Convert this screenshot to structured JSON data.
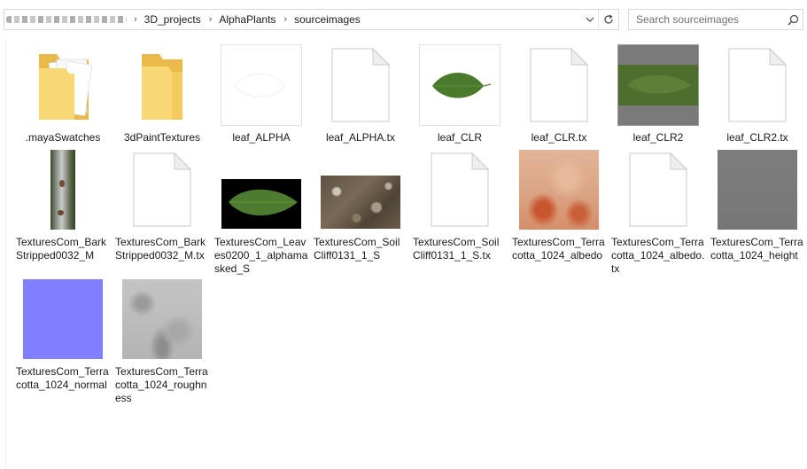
{
  "address_bar": {
    "breadcrumbs": [
      "3D_projects",
      "AlphaPlants",
      "sourceimages"
    ],
    "dropdown_icon": "chevron-down-icon",
    "refresh_icon": "refresh-icon"
  },
  "search": {
    "placeholder": "Search sourceimages",
    "icon": "search-icon"
  },
  "items": [
    {
      "name": ".mayaSwatches",
      "kind": "folder-with-files"
    },
    {
      "name": "3dPaintTextures",
      "kind": "folder"
    },
    {
      "name": "leaf_ALPHA",
      "kind": "image-white-leaf"
    },
    {
      "name": "leaf_ALPHA.tx",
      "kind": "document"
    },
    {
      "name": "leaf_CLR",
      "kind": "image-leaf-on-white"
    },
    {
      "name": "leaf_CLR.tx",
      "kind": "document"
    },
    {
      "name": "leaf_CLR2",
      "kind": "image-leaf-on-gray"
    },
    {
      "name": "leaf_CLR2.tx",
      "kind": "document"
    },
    {
      "name": "TexturesCom_BarkStripped0032_M",
      "kind": "image-bark"
    },
    {
      "name": "TexturesCom_BarkStripped0032_M.tx",
      "kind": "document"
    },
    {
      "name": "TexturesCom_Leaves0200_1_alphamasked_S",
      "kind": "image-leaf-on-black"
    },
    {
      "name": "TexturesCom_SoilCliff0131_1_S",
      "kind": "image-soil"
    },
    {
      "name": "TexturesCom_SoilCliff0131_1_S.tx",
      "kind": "document"
    },
    {
      "name": "TexturesCom_Terracotta_1024_albedo",
      "kind": "image-terracotta"
    },
    {
      "name": "TexturesCom_Terracotta_1024_albedo.tx",
      "kind": "document"
    },
    {
      "name": "TexturesCom_Terracotta_1024_height",
      "kind": "image-gray"
    },
    {
      "name": "TexturesCom_Terracotta_1024_normal",
      "kind": "image-normal-blue"
    },
    {
      "name": "TexturesCom_Terracotta_1024_roughness",
      "kind": "image-roughness"
    }
  ],
  "colors": {
    "folder_yellow": "#f8d775",
    "normal_map_blue": "#8080ff",
    "leaf_green": "#4a7a2c",
    "height_gray": "#7b7b7b"
  }
}
